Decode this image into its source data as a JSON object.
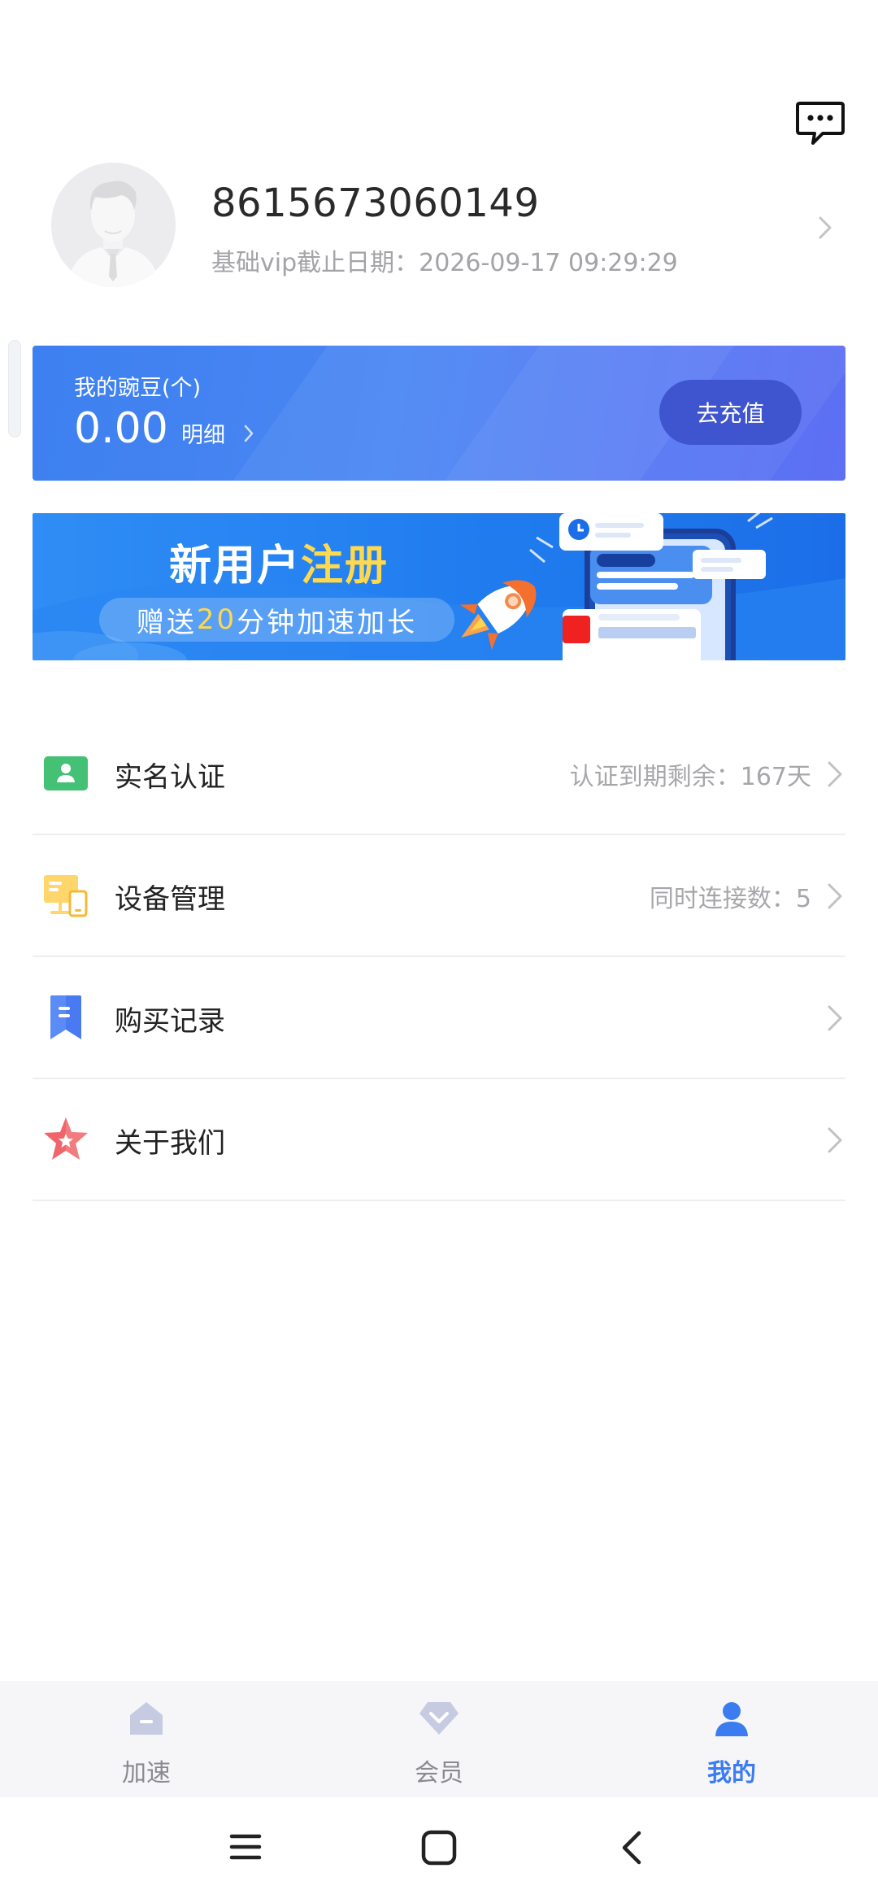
{
  "header": {
    "message_icon": "chat-bubble-icon"
  },
  "profile": {
    "phone": "8615673060149",
    "vip_label": "基础vip截止日期：",
    "vip_date": "2026-09-17 09:29:29"
  },
  "balance": {
    "label": "我的豌豆(个)",
    "value": "0.00",
    "detail_label": "明细",
    "recharge_label": "去充值"
  },
  "promo": {
    "title_part1": "新用户",
    "title_part2": "注册",
    "sub_part1": "赠送",
    "sub_highlight": "20",
    "sub_part2": "分钟加速加长"
  },
  "menu": [
    {
      "label": "实名认证",
      "info": "认证到期剩余：167天",
      "icon": "id-card-icon"
    },
    {
      "label": "设备管理",
      "info": "同时连接数：5",
      "icon": "devices-icon"
    },
    {
      "label": "购买记录",
      "info": "",
      "icon": "bookmark-icon"
    },
    {
      "label": "关于我们",
      "info": "",
      "icon": "star-icon"
    }
  ],
  "tabs": [
    {
      "label": "加速",
      "icon": "home-icon",
      "active": false
    },
    {
      "label": "会员",
      "icon": "diamond-icon",
      "active": false
    },
    {
      "label": "我的",
      "icon": "user-icon",
      "active": true
    }
  ],
  "colors": {
    "accent": "#3b7cf0",
    "balance_card": "#4a86f3",
    "recharge_button": "#3f55cf",
    "promo_bg": "#1f7bee",
    "promo_highlight": "#ffd84c"
  }
}
